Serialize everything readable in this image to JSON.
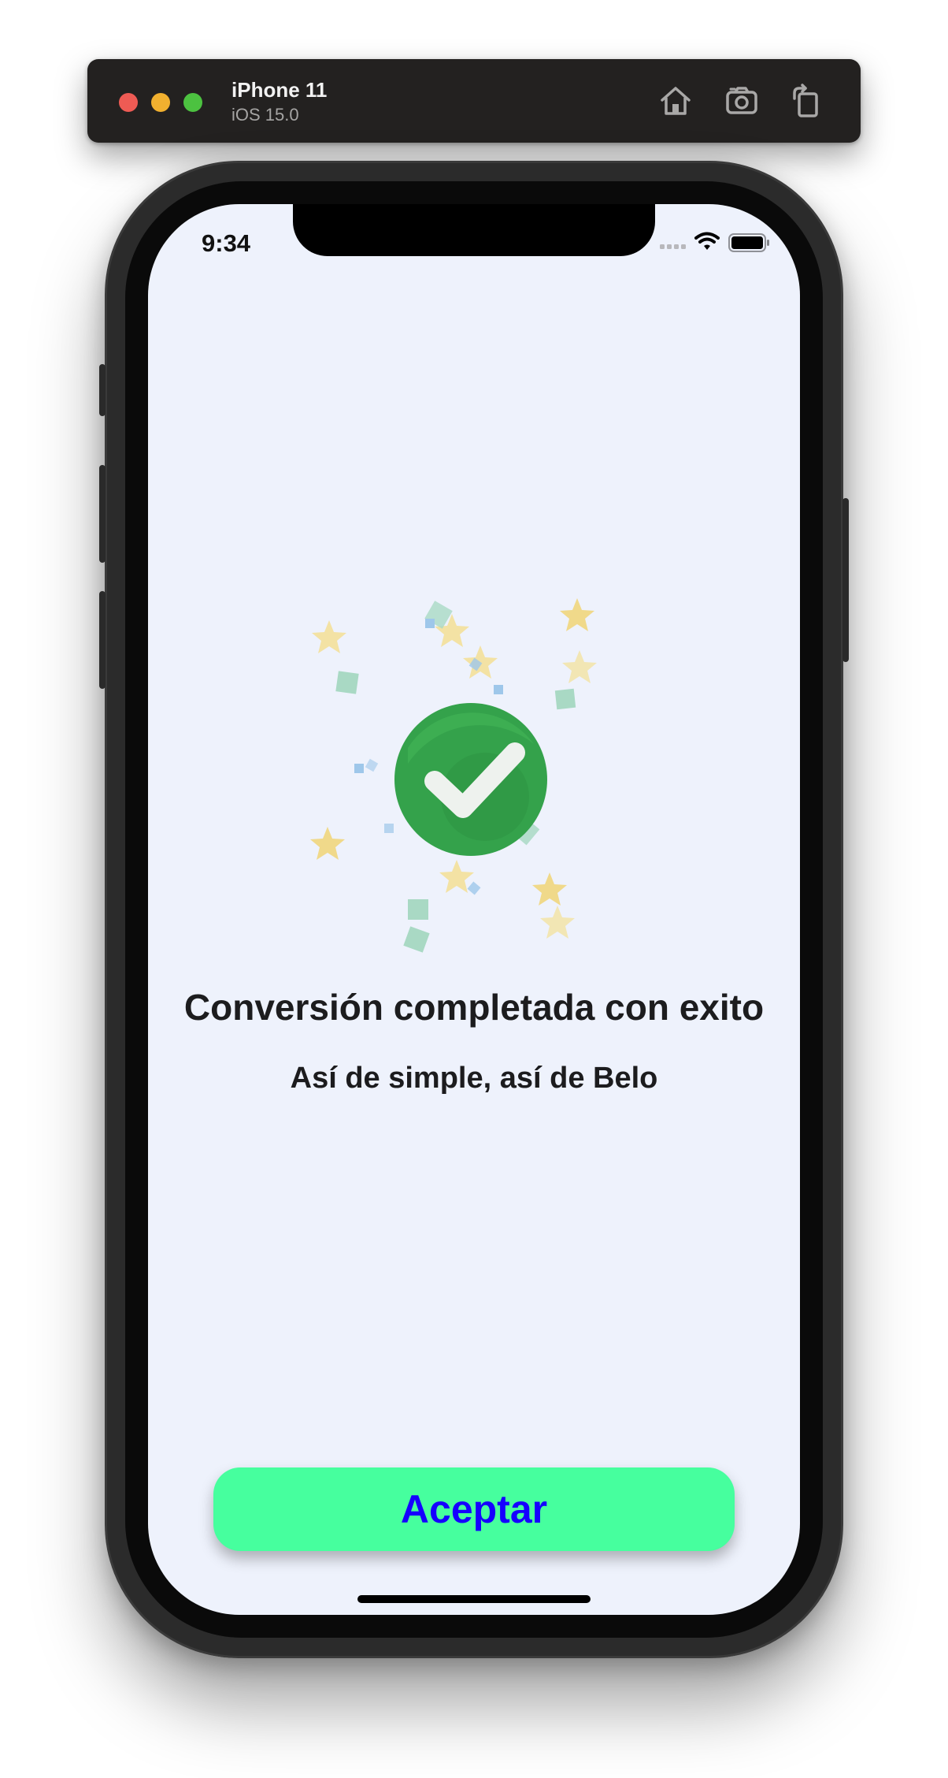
{
  "simulator": {
    "device_name": "iPhone 11",
    "os_version": "iOS 15.0",
    "toolbar_icons": [
      "home-icon",
      "screenshot-icon",
      "rotate-icon"
    ]
  },
  "status_bar": {
    "time": "9:34",
    "icons": [
      "signal-icon",
      "wifi-icon",
      "battery-icon"
    ]
  },
  "success": {
    "icon": "check-circle-icon",
    "title": "Conversión completada con exito",
    "subtitle": "Así de simple, así de Belo"
  },
  "actions": {
    "accept_label": "Aceptar"
  },
  "colors": {
    "screen_background": "#eef2fc",
    "button_background": "#46ff9e",
    "button_text": "#1600ff",
    "check_green": "#34a24b"
  }
}
